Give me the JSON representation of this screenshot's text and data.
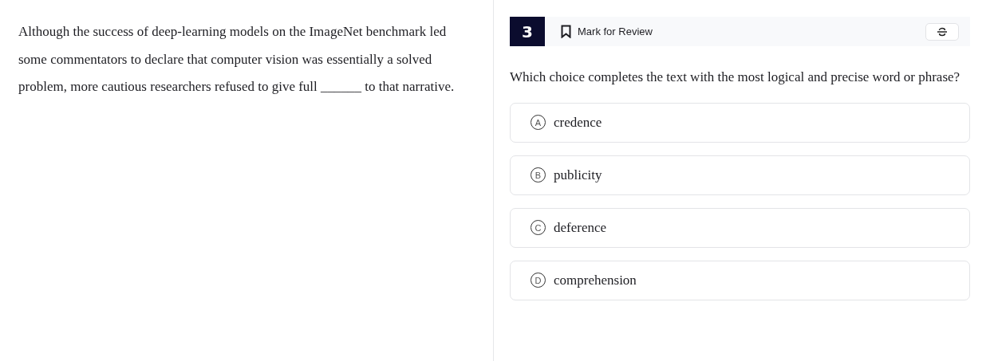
{
  "passage": "Although the success of deep-learning models on the ImageNet benchmark led some commentators to declare that computer vision was essentially a solved problem, more cautious researchers refused to give full ______ to that narrative.",
  "question": {
    "number": "3",
    "mark_for_review": {
      "label": "Mark for Review",
      "checked": false
    },
    "prompt": "Which choice completes the text with the most logical and precise word or phrase?",
    "choices": [
      {
        "letter": "A",
        "text": "credence",
        "selected": false
      },
      {
        "letter": "B",
        "text": "publicity",
        "selected": false
      },
      {
        "letter": "C",
        "text": "deference",
        "selected": false
      },
      {
        "letter": "D",
        "text": "comprehension",
        "selected": false
      }
    ]
  }
}
